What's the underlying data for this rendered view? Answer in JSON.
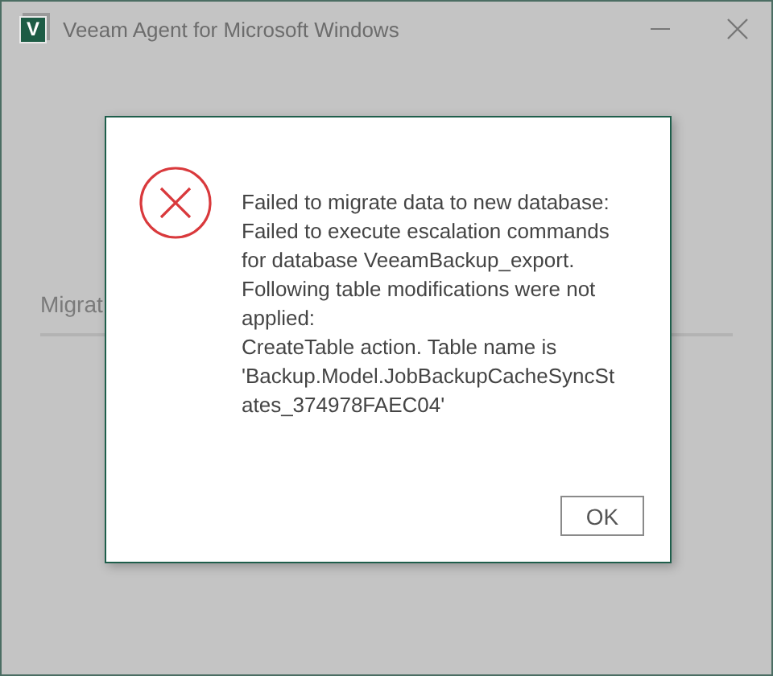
{
  "window": {
    "title": "Veeam Agent for Microsoft Windows",
    "logo": "V"
  },
  "background": {
    "label": "Migrat"
  },
  "dialog": {
    "kind": "error",
    "message": "Failed to migrate data to new database: Failed to execute escalation commands for database VeeamBackup_export. Following table modifications were not applied:\nCreateTable action. Table name is 'Backup.Model.JobBackupCacheSyncStates_374978FAEC04'",
    "buttons": [
      "OK"
    ]
  }
}
